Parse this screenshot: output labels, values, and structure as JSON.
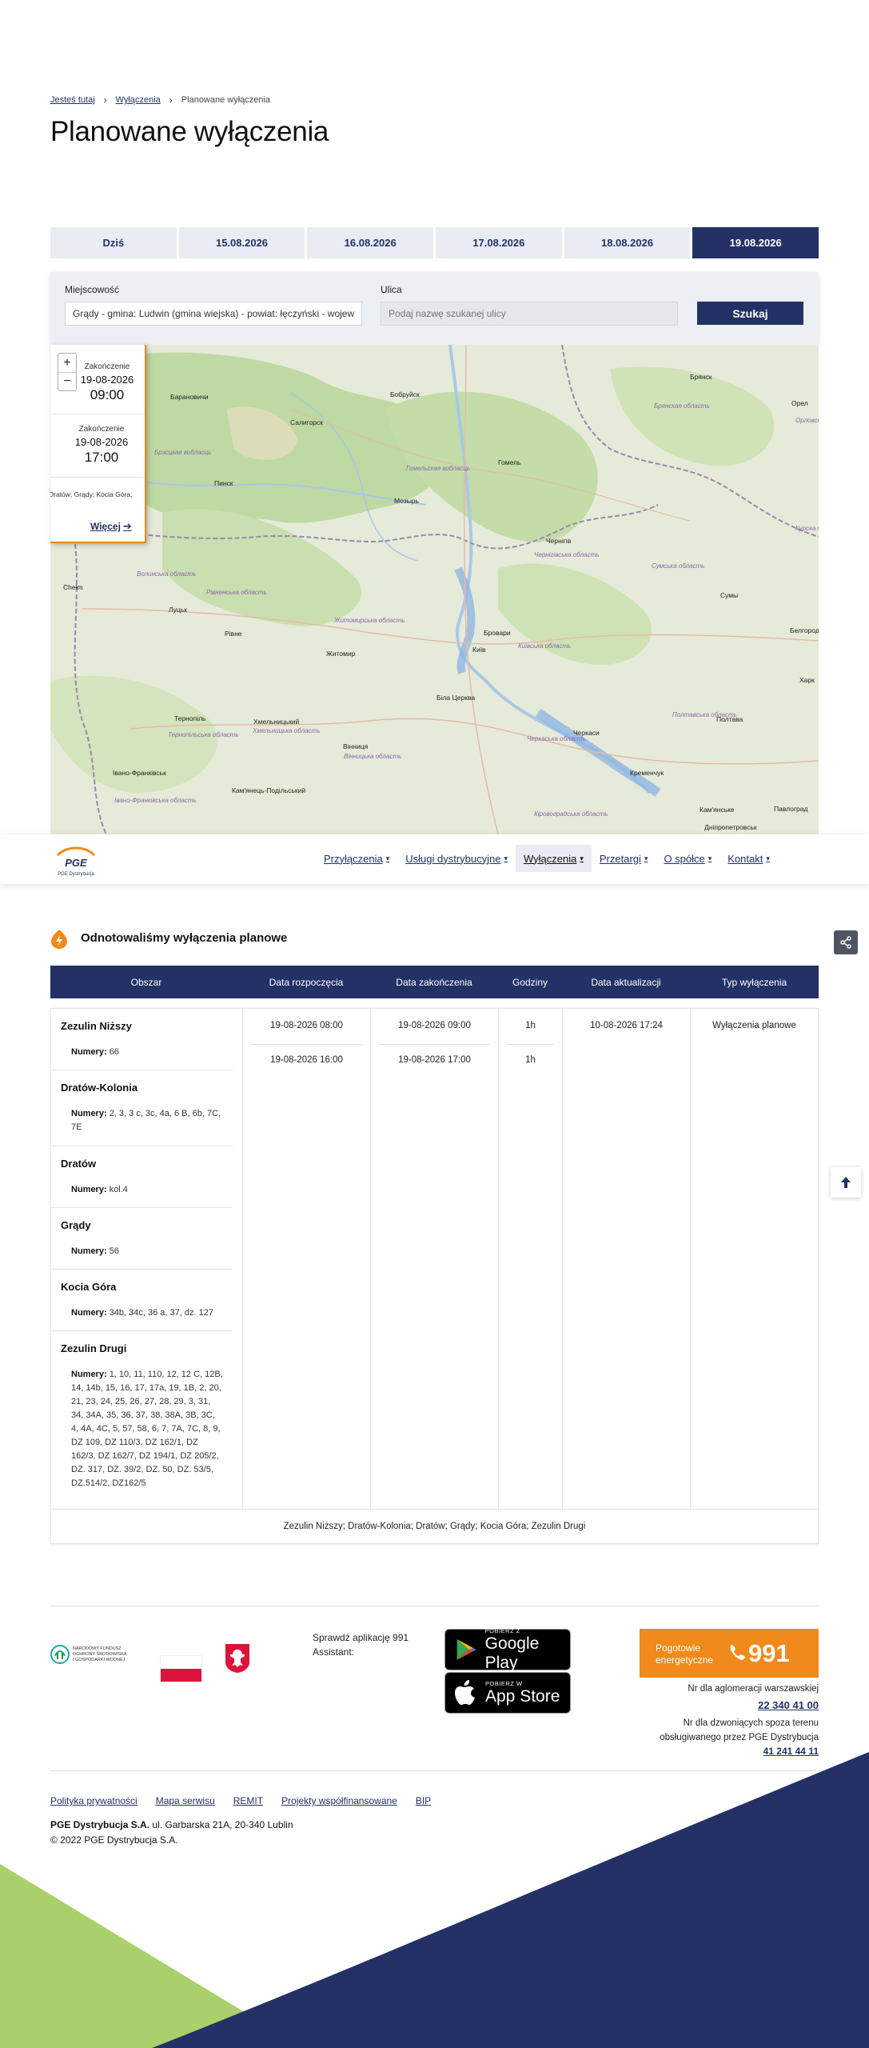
{
  "breadcrumb": {
    "home": "Jesteś tutaj",
    "parent": "Wyłączenia",
    "current": "Planowane wyłączenia"
  },
  "page_title": "Planowane wyłączenia",
  "date_tabs": [
    "Dziś",
    "15.08.2026",
    "16.08.2026",
    "17.08.2026",
    "18.08.2026",
    "19.08.2026"
  ],
  "active_tab": "19.08.2026",
  "search": {
    "city_label": "Miejscowość",
    "city_value": "Grądy - gmina: Ludwin (gmina wiejska) - powiat: łęczyński - województwo: lubelskie",
    "street_label": "Ulica",
    "street_placeholder": "Podaj nazwę szukanej ulicy",
    "button": "Szukaj"
  },
  "map": {
    "zoom_in": "+",
    "zoom_out": "−",
    "cities": [
      "Брянск",
      "Барановичи",
      "Бобруйск",
      "Салигорск",
      "Гомель",
      "Пинск",
      "Мозырь",
      "Чернігів",
      "Орел",
      "Сумы",
      "Луцьк",
      "Рівне",
      "Житомир",
      "Київ",
      "Біла Церква",
      "Бровари",
      "Тернопіль",
      "Хмельницький",
      "Вінниця",
      "Черкаси",
      "Полтава",
      "Івано-Франківськ",
      "Кременчук",
      "Кам'янець-Подільський",
      "Павлоград",
      "Кам'янське",
      "Дніпропетровськ",
      "Белгород",
      "Харк",
      "Сумы",
      "Chełm"
    ],
    "regions": [
      "Брэсцкая вобласць",
      "Гомельская вобласць",
      "Брянская область",
      "Волинська область",
      "Рівненська область",
      "Житомирська область",
      "Київська область",
      "Чернігівська область",
      "Сумська область",
      "Черкаська область",
      "Полтавська область",
      "Хмельницька область",
      "Тернопільська область",
      "Кіровоградська область",
      "Вінницька область",
      "Івано-Франківська область",
      "Курска область",
      "Орловска область"
    ]
  },
  "popup": {
    "end_label_1": "Zakończenie",
    "end_date_1": "19-08-2026",
    "end_time_1": "09:00",
    "end_label_2": "Zakończenie",
    "end_date_2": "19-08-2026",
    "end_time_2": "17:00",
    "areas": "Dratów; Grądy; Kocia Góra;",
    "more": "Więcej"
  },
  "nav": {
    "items": [
      "Przyłączenia",
      "Usługi dystrybucyjne",
      "Wyłączenia",
      "Przetargi",
      "O spółce",
      "Kontakt"
    ],
    "active": "Wyłączenia",
    "logo_text": "PGE",
    "logo_sub": "PGE Dystrybucja"
  },
  "notice": {
    "title": "Odnotowaliśmy wyłączenia planowe"
  },
  "table": {
    "headers": [
      "Obszar",
      "Data rozpoczęcia",
      "Data zakończenia",
      "Godziny",
      "Data aktualizacji",
      "Typ wyłączenia"
    ],
    "numbers_label": "Numery:",
    "areas": [
      {
        "name": "Zezulin Niższy",
        "numbers": "66"
      },
      {
        "name": "Dratów-Kolonia",
        "numbers": "2, 3, 3 c, 3c, 4a, 6 B, 6b, 7C, 7E"
      },
      {
        "name": "Dratów",
        "numbers": "kol.4"
      },
      {
        "name": "Grądy",
        "numbers": "56"
      },
      {
        "name": "Kocia Góra",
        "numbers": "34b, 34c, 36 a, 37, dz. 127"
      },
      {
        "name": "Zezulin Drugi",
        "numbers": "1, 10, 11, 110, 12, 12 C, 12B, 14, 14b, 15, 16, 17, 17a, 19, 1B, 2, 20, 21, 23, 24, 25, 26, 27, 28, 29, 3, 31, 34, 34A, 35, 36, 37, 38, 38A, 3B, 3C, 4, 4A, 4C, 5, 57, 58, 6, 7, 7A, 7C, 8, 9, DZ 109, DZ 110/3, DZ 162/1, DZ 162/3, DZ 162/7, DZ 194/1, DZ 205/2, DZ. 317, DZ. 39/2, DZ. 50, DZ. 53/5, DZ.514/2, DZ162/5"
      }
    ],
    "start_dates": [
      "19-08-2026 08:00",
      "19-08-2026 16:00"
    ],
    "end_dates": [
      "19-08-2026 09:00",
      "19-08-2026 17:00"
    ],
    "hours": [
      "1h",
      "1h"
    ],
    "updated": "10-08-2026 17:24",
    "type": "Wyłączenia planowe",
    "footer": "Zezulin Niższy; Dratów-Kolonia; Dratów; Grądy; Kocia Góra; Zezulin Drugi"
  },
  "footer": {
    "fund_text": [
      "NARODOWY FUNDUSZ",
      "OCHRONY ŚRODOWISKA",
      "I GOSPODARKI WODNEJ"
    ],
    "app_text": "Sprawdź aplikację 991 Assistant:",
    "google_small": "POBIERZ Z",
    "google_big": "Google Play",
    "apple_small": "POBIERZ W",
    "apple_big": "App Store",
    "emergency_label": "Pogotowie energetyczne",
    "emergency_number": "991",
    "warsaw_label": "Nr dla aglomeracji warszawskiej",
    "warsaw_number": "22 340 41 00",
    "outside_label": "Nr dla dzwoniących spoza terenu obsługiwanego przez PGE Dystrybucja",
    "outside_number": "41 241 44 11",
    "links": [
      "Polityka prywatności",
      "Mapa serwisu",
      "REMIT",
      "Projekty współfinansowane",
      "BIP"
    ],
    "company_name": "PGE Dystrybucja S.A.",
    "company_address": "ul. Garbarska 21A, 20-340 Lublin",
    "copyright": "© 2022 PGE Dystrybucja S.A."
  },
  "colors": {
    "navy": "#233166",
    "orange": "#f08a1b",
    "green": "#a9d06a"
  }
}
